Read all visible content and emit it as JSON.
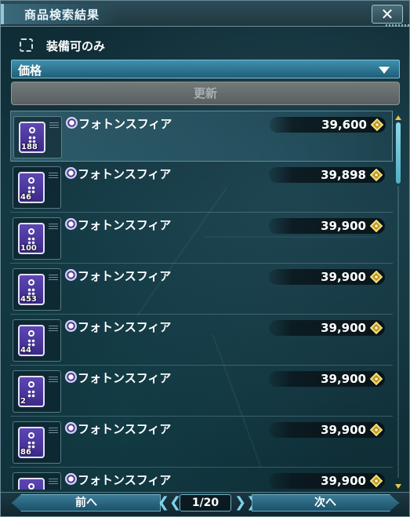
{
  "window": {
    "title": "商品検索結果",
    "close_label": "✕"
  },
  "filter": {
    "equip_only_label": "装備可のみ",
    "checked": false
  },
  "sort": {
    "selected": "価格"
  },
  "update_button": {
    "label": "更新",
    "enabled": false
  },
  "items": [
    {
      "name": "フォトンスフィア",
      "qty": "188",
      "price": "39,600",
      "selected": true
    },
    {
      "name": "フォトンスフィア",
      "qty": "46",
      "price": "39,898",
      "selected": false
    },
    {
      "name": "フォトンスフィア",
      "qty": "100",
      "price": "39,900",
      "selected": false
    },
    {
      "name": "フォトンスフィア",
      "qty": "453",
      "price": "39,900",
      "selected": false
    },
    {
      "name": "フォトンスフィア",
      "qty": "44",
      "price": "39,900",
      "selected": false
    },
    {
      "name": "フォトンスフィア",
      "qty": "2",
      "price": "39,900",
      "selected": false
    },
    {
      "name": "フォトンスフィア",
      "qty": "86",
      "price": "39,900",
      "selected": false
    },
    {
      "name": "フォトンスフィア",
      "qty": "",
      "price": "39,900",
      "selected": false
    }
  ],
  "pager": {
    "prev_label": "前へ",
    "next_label": "次へ",
    "page_text": "1/20",
    "prev_chevrons": "❮❮",
    "next_chevrons": "❯❯"
  },
  "icons": {
    "item_icon": "photon-sphere-icon",
    "currency_icon": "meseta-icon",
    "close_icon": "close-icon",
    "dropdown_icon": "chevron-down-icon"
  },
  "colors": {
    "accent": "#3f8fad",
    "price_coin": "#e3c64a",
    "item_tag": "#5d47b4"
  }
}
